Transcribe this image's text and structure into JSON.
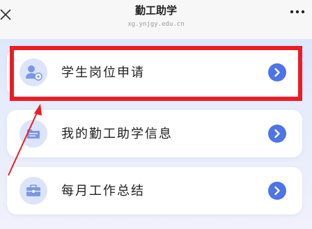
{
  "header": {
    "title": "勤工助学",
    "subtitle": "xg.ynjgy.edu.cn"
  },
  "menu": [
    {
      "label": "学生岗位申请",
      "icon": "user-badge-icon"
    },
    {
      "label": "我的勤工助学信息",
      "icon": "folder-icon"
    },
    {
      "label": "每月工作总结",
      "icon": "briefcase-icon"
    }
  ],
  "annotation": {
    "color": "#ee1b24"
  },
  "colors": {
    "accent": "#4d74e8",
    "icon_bg": "#dbe4fa",
    "icon_fg": "#7b97e6"
  }
}
